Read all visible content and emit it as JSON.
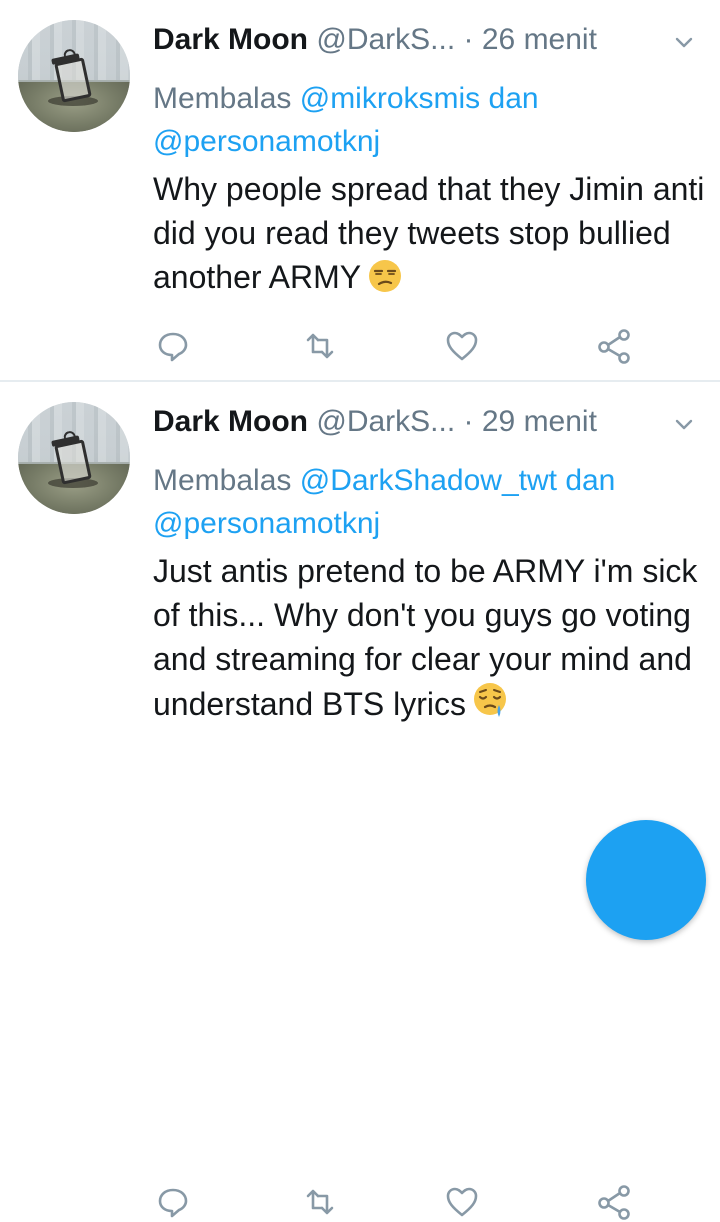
{
  "tweets": [
    {
      "name": "Dark Moon",
      "handle": "@DarkS...",
      "separator": "·",
      "time": "26 menit",
      "reply_prefix": "Membalas",
      "reply_mention_1": "@mikroksmis",
      "reply_conj": "dan",
      "reply_mention_2": "@personamotknj",
      "text": "Why people spread that they Jimin anti did you read they tweets stop bullied another ARMY",
      "emoji": "unamused-face-icon"
    },
    {
      "name": "Dark Moon",
      "handle": "@DarkS...",
      "separator": "·",
      "time": "29 menit",
      "reply_prefix": "Membalas",
      "reply_mention_1": "@DarkShadow_twt",
      "reply_conj": "dan",
      "reply_mention_2": "@personamotknj",
      "text": "Just antis pretend to be ARMY i'm sick of this... Why don't you guys go voting and streaming for clear your mind and understand BTS lyrics",
      "emoji": "sleepy-face-icon"
    }
  ],
  "icons": {
    "reply": "reply-icon",
    "retweet": "retweet-icon",
    "like": "heart-icon",
    "share": "share-icon",
    "menu": "chevron-down-icon"
  },
  "colors": {
    "accent": "#1da1f2",
    "secondary_text": "#657786",
    "primary_text": "#14171a"
  }
}
